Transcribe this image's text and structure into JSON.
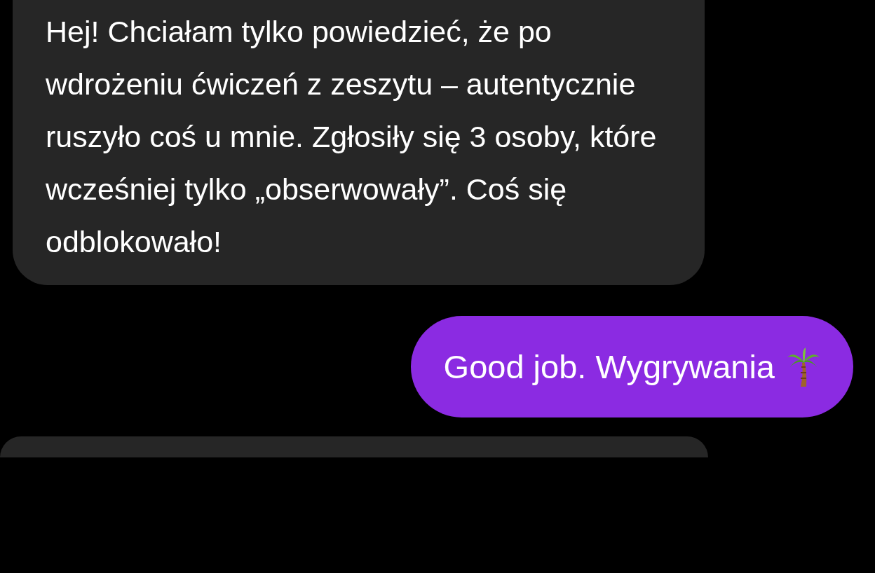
{
  "messages": [
    {
      "kind": "received",
      "text": "Hej! Chciałam tylko powiedzieć, że po wdrożeniu ćwiczeń z zeszytu – autentycznie ruszyło coś u mnie. Zgłosiły się 3 osoby, które wcześniej tylko „obserwowały”. Coś się odblokowało!"
    },
    {
      "kind": "sent",
      "text": "Good job. Wygrywania"
    }
  ]
}
